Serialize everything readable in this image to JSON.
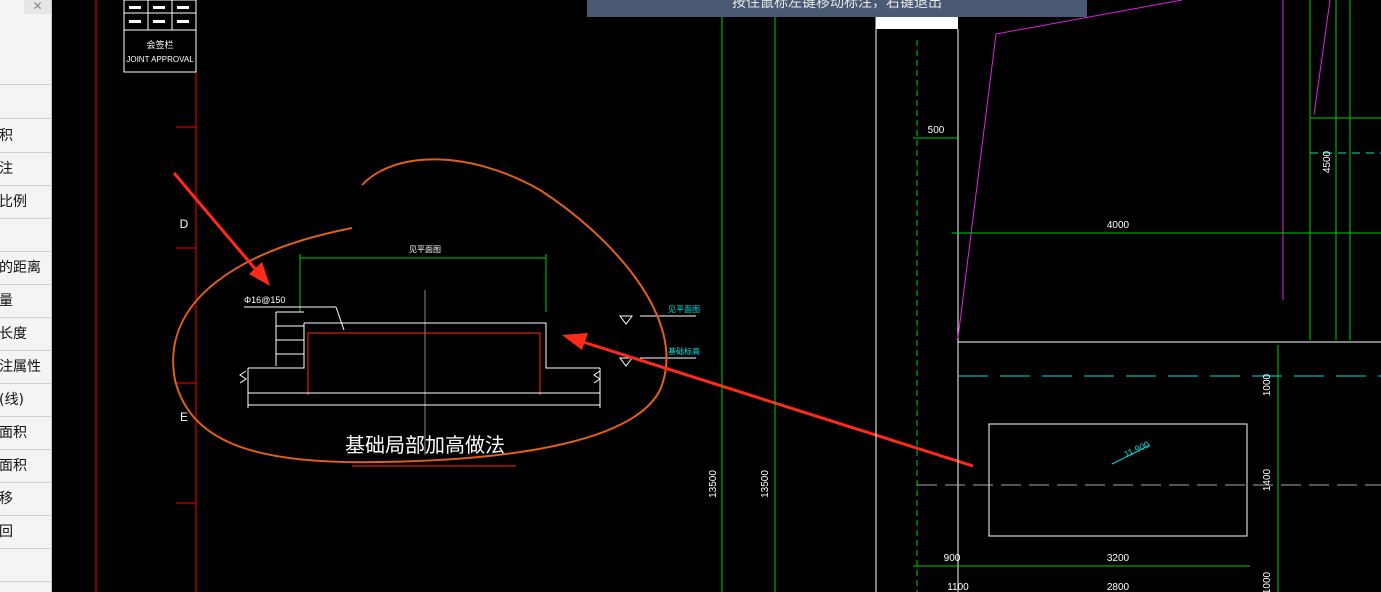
{
  "sidebar": {
    "close_label": "✕",
    "items": [
      {
        "label": "积"
      },
      {
        "label": "注"
      },
      {
        "label": "比例"
      },
      {
        "label": ""
      },
      {
        "label": "的距离"
      },
      {
        "label": "量"
      },
      {
        "label": "长度"
      },
      {
        "label": "注属性"
      },
      {
        "label": "(线)"
      },
      {
        "label": "面积"
      },
      {
        "label": "面积"
      },
      {
        "label": "移"
      },
      {
        "label": "回"
      }
    ]
  },
  "command_prompt": "按住鼠标左键移动标注，右键退出",
  "title_block": {
    "cn_label": "会签栏",
    "en_label": "JOINT APPROVAL"
  },
  "drawing": {
    "grid_labels": [
      "D",
      "E"
    ],
    "detail": {
      "title": "基础局部加高做法",
      "rebar_label": "Φ16@150",
      "top_label": "见平面图",
      "level_label_top": "见平面图",
      "level_label_bottom": "基础标高"
    },
    "dimensions": {
      "d500": "500",
      "d4000": "4000",
      "d4500": "4500",
      "d13500_a": "13500",
      "d13500_b": "13500",
      "d1000_top": "1000",
      "d1400": "1400",
      "d1000_bottom": "1000",
      "d900": "900",
      "d3200": "3200",
      "d1100": "1100",
      "d2800": "2800",
      "elevation": "11.900"
    }
  },
  "colors": {
    "annotation_red": "#ff2a1a",
    "markup_orange": "#e0601a",
    "dim_green": "#00d000",
    "cyan": "#00e0e0",
    "magenta": "#e020e0"
  }
}
